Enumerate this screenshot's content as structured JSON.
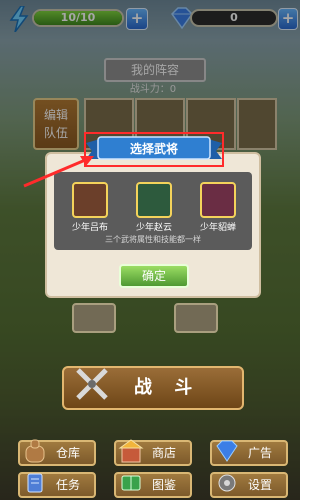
{
  "top_bar": {
    "energy": {
      "label": "10/10",
      "fill_fraction": 1.0
    },
    "gems": {
      "label": "0"
    },
    "plus_label": "+"
  },
  "lineup": {
    "title": "我的阵容",
    "power_label": "战斗力：0",
    "edit_team_line1": "编辑",
    "edit_team_line2": "队伍"
  },
  "dialog": {
    "title": "选择武将",
    "heroes": [
      {
        "name": "少年吕布"
      },
      {
        "name": "少年赵云"
      },
      {
        "name": "少年貂蝉"
      }
    ],
    "hint": "三个武将属性和技能都一样",
    "confirm_label": "确定"
  },
  "fight_label": "战 斗",
  "bottom_menu": {
    "row1": [
      {
        "label": "仓库",
        "icon": "bag-icon"
      },
      {
        "label": "商店",
        "icon": "shop-icon"
      },
      {
        "label": "广告",
        "icon": "gem-icon"
      }
    ],
    "row2": [
      {
        "label": "任务",
        "icon": "scroll-icon"
      },
      {
        "label": "图鉴",
        "icon": "book-icon"
      },
      {
        "label": "设置",
        "icon": "gear-icon"
      }
    ]
  },
  "colors": {
    "ribbon": "#2f7fd1",
    "highlight": "#ff2b2b"
  }
}
